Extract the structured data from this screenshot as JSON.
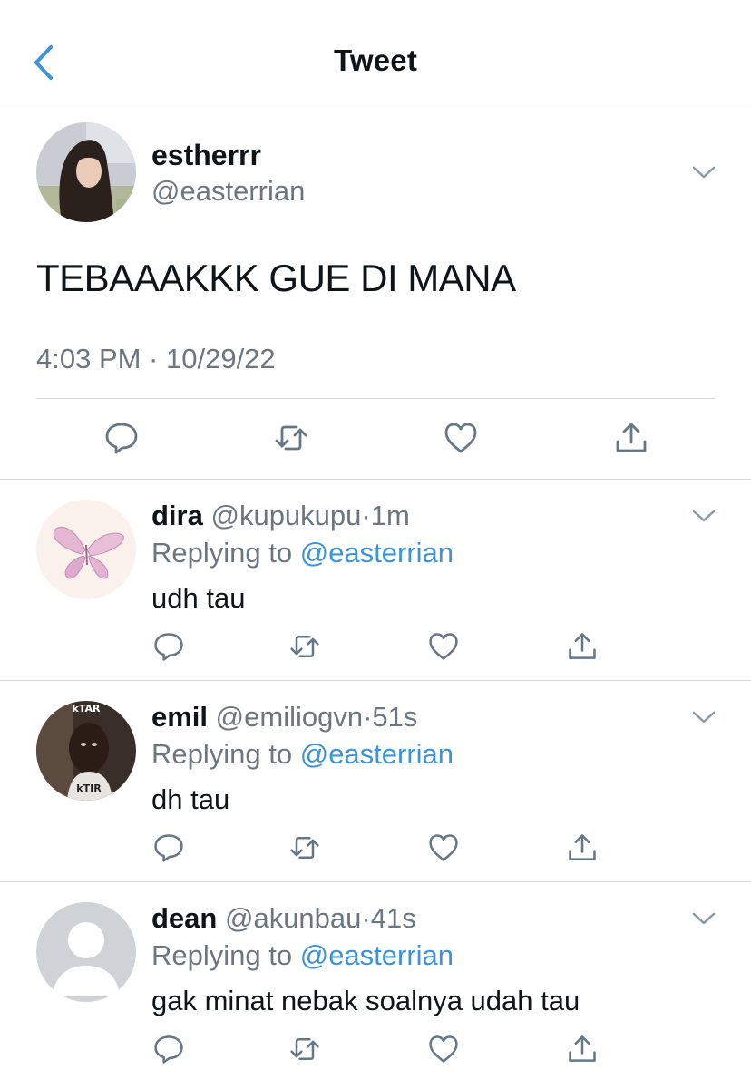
{
  "header": {
    "title": "Tweet"
  },
  "tweet": {
    "display_name": "estherrr",
    "handle": "@easterrian",
    "text": "TEBAAAKKK GUE DI MANA",
    "timestamp": "4:03 PM · 10/29/22"
  },
  "replies": [
    {
      "display_name": "dira",
      "handle": "@kupukupu",
      "time": "1m",
      "replying_label": "Replying to",
      "replying_to": "@easterrian",
      "text": "udh tau"
    },
    {
      "display_name": "emil",
      "handle": "@emiliogvn",
      "time": "51s",
      "replying_label": "Replying to",
      "replying_to": "@easterrian",
      "text": "dh tau",
      "avatar_caption_top": "kTAR",
      "avatar_caption_bottom": "kTIR"
    },
    {
      "display_name": "dean",
      "handle": "@akunbau",
      "time": "41s",
      "replying_label": "Replying to",
      "replying_to": "@easterrian",
      "text": "gak minat nebak soalnya udah tau"
    }
  ],
  "separator": "·",
  "colors": {
    "link": "#3b94d9",
    "muted": "#6b7680",
    "divider": "#d6d6d6",
    "text": "#0f1419"
  },
  "icons": [
    "back-chevron-icon",
    "chevron-down-icon",
    "reply-icon",
    "retweet-icon",
    "like-icon",
    "share-icon"
  ]
}
